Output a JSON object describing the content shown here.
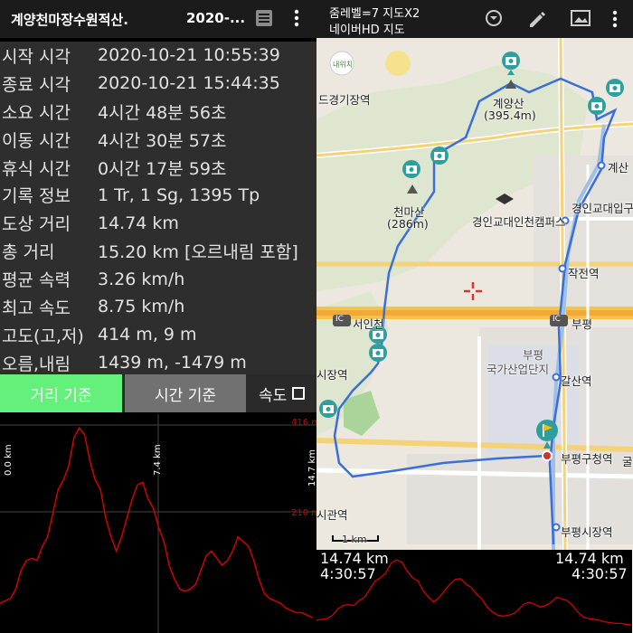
{
  "header": {
    "title": "계양천마장수원적산.",
    "title_suffix": "2020-..."
  },
  "stats": [
    {
      "label": "시작 시각",
      "value": "2020-10-21 10:55:39"
    },
    {
      "label": "종료 시각",
      "value": "2020-10-21 15:44:35"
    },
    {
      "label": "소요 시간",
      "value": "4시간 48분 56초"
    },
    {
      "label": "이동 시간",
      "value": "4시간 30분 57초"
    },
    {
      "label": "휴식 시간",
      "value": "0시간 17분 59초"
    },
    {
      "label": "기록 정보",
      "value": "1 Tr, 1 Sg, 1395 Tp"
    },
    {
      "label": "도상 거리",
      "value": "14.74 km"
    },
    {
      "label": "총 거리",
      "value": "15.20 km [오르내림 포함]"
    },
    {
      "label": "평균 속력",
      "value": "3.26 km/h"
    },
    {
      "label": "최고 속도",
      "value": "8.75 km/h"
    },
    {
      "label": "고도(고,저)",
      "value": "414 m, 9 m"
    },
    {
      "label": "오름,내림",
      "value": "1439 m, -1479 m"
    }
  ],
  "tabs": {
    "distance": "거리 기준",
    "time": "시간 기준",
    "speed": "속도"
  },
  "profile": {
    "x_start": "0.0 km",
    "x_mid": "7.4 km",
    "x_end": "14.7 km",
    "y_max": "416 m",
    "y_mid": "210 m",
    "elevations": [
      40,
      45,
      50,
      70,
      110,
      130,
      135,
      130,
      160,
      180,
      230,
      280,
      300,
      330,
      390,
      410,
      395,
      340,
      300,
      280,
      220,
      180,
      150,
      180,
      220,
      260,
      290,
      295,
      260,
      240,
      200,
      170,
      120,
      90,
      70,
      65,
      70,
      80,
      110,
      140,
      150,
      135,
      120,
      130,
      150,
      180,
      170,
      160,
      130,
      90,
      60,
      50,
      45,
      40,
      30,
      25,
      20,
      20,
      15,
      10
    ]
  },
  "map": {
    "zoom_line1": "줌레벨=7 지도X2",
    "zoom_line2": "네이버HD 지도",
    "labels": {
      "gyeonggi": "드경기장역",
      "gyeyangsan": "계양산",
      "gyeyangsan_alt": "(395.4m)",
      "gyesan": "계산",
      "cheonmasan": "천마산",
      "cheonmasan_alt": "(286m)",
      "univ": "경인교대입구",
      "campus": "경인교대인천캠퍼스",
      "jakjeon": "작전역",
      "seoin": "서인천",
      "bupyeong_ic": "부평",
      "ic1": "IC",
      "ic2": "IC",
      "bupyeong_complex1": "부평",
      "bupyeong_complex2": "국가산업단지",
      "market": "시장역",
      "galsan": "갈산역",
      "office": "부평구청역",
      "gul": "굴",
      "hall": "시관역",
      "market2": "부평시장역",
      "scale": "1 km",
      "myloc": "내위치"
    },
    "overlay": {
      "dist_left": "14.74 km",
      "time_left": "4:30:57",
      "dist_right": "14.74 km",
      "time_right": "4:30:57"
    }
  },
  "colors": {
    "accent_green": "#63f07b",
    "route_blue": "#3a6fd8",
    "profile_red": "#d10000"
  }
}
